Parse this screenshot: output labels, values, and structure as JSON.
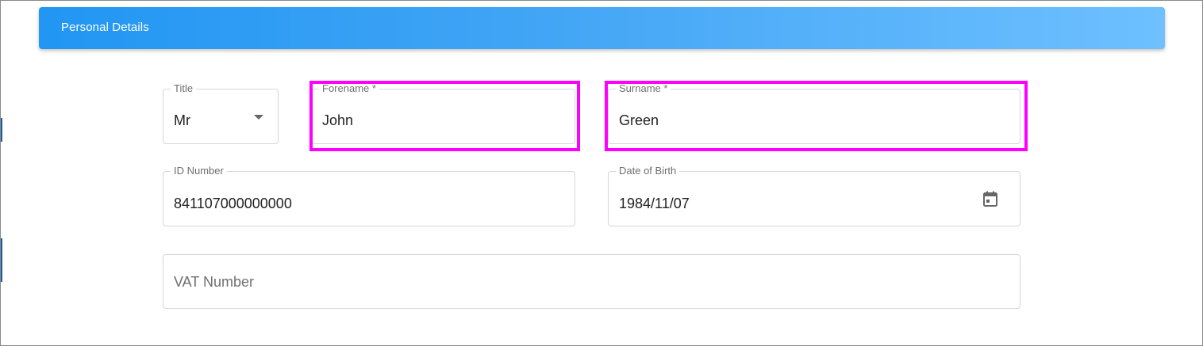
{
  "section": {
    "title": "Personal Details"
  },
  "form": {
    "title_field": {
      "label": "Title",
      "value": "Mr",
      "icon": "chevron-down-icon"
    },
    "forename_field": {
      "label": "Forename *",
      "value": "John"
    },
    "surname_field": {
      "label": "Surname *",
      "value": "Green"
    },
    "id_number_field": {
      "label": "ID Number",
      "value": "841107000000000"
    },
    "dob_field": {
      "label": "Date of Birth",
      "value": "1984/11/07",
      "icon": "calendar-icon"
    },
    "vat_field": {
      "placeholder": "VAT Number"
    }
  },
  "colors": {
    "header_start": "#2196f3",
    "header_end": "#6ec0ff",
    "highlight": "#ff00ff"
  }
}
